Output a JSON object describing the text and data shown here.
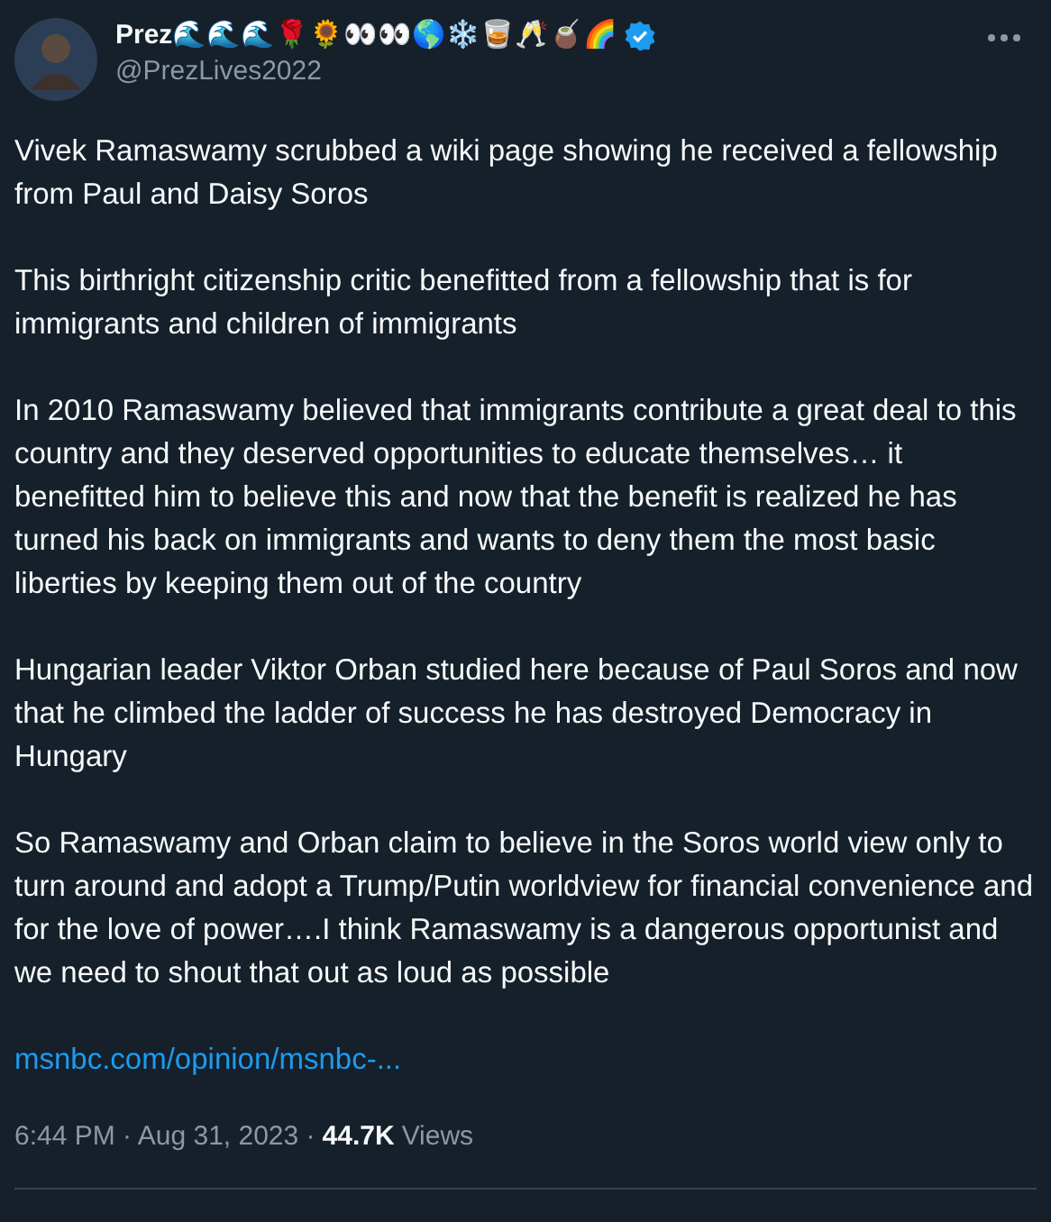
{
  "author": {
    "name": "Prez🌊🌊🌊🌹🌻👀👀🌎❄️🥃🥂🧉🌈",
    "verified": true,
    "handle": "@PrezLives2022"
  },
  "paragraphs": [
    "Vivek Ramaswamy scrubbed a wiki page showing he received a fellowship from Paul and Daisy Soros",
    "This birthright citizenship critic benefitted from a fellowship that is for immigrants and children of immigrants",
    "In 2010 Ramaswamy believed that immigrants contribute a great deal to this country and they deserved opportunities to educate themselves… it benefitted him to believe this and now that the benefit is realized he has turned his back on immigrants and wants to deny them the most basic liberties by keeping them out of the country",
    "Hungarian leader Viktor Orban studied here because of Paul Soros and now that he climbed the ladder of success he has destroyed Democracy in Hungary",
    "So Ramaswamy and Orban claim to believe in the Soros world view only to turn around and adopt a Trump/Putin worldview for financial convenience and for the love of power….I think Ramaswamy is a dangerous opportunist and we need to shout that out as loud as possible"
  ],
  "link": "msnbc.com/opinion/msnbc-...",
  "meta": {
    "time": "6:44 PM · Aug 31, 2023 ·",
    "views_count": "44.7K",
    "views_label": "Views"
  }
}
